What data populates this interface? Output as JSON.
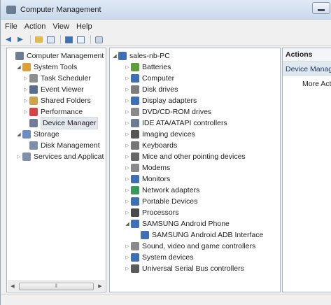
{
  "window": {
    "title": "Computer Management"
  },
  "menu": [
    "File",
    "Action",
    "View",
    "Help"
  ],
  "toolbar": [
    "back-arrow-icon",
    "forward-arrow-icon",
    "up-folder-icon",
    "show-hide-tree-icon",
    "properties-icon",
    "help-icon",
    "scan-hardware-icon"
  ],
  "left_tree": [
    {
      "label": "Computer Management",
      "level": 0,
      "arrow": "",
      "icon": "computer-management-icon",
      "color": "#6b7d93"
    },
    {
      "label": "System Tools",
      "level": 1,
      "arrow": "open",
      "icon": "system-tools-icon",
      "color": "#d9a23a"
    },
    {
      "label": "Task Scheduler",
      "level": 2,
      "arrow": "closed",
      "icon": "clock-icon",
      "color": "#8f8f8f"
    },
    {
      "label": "Event Viewer",
      "level": 2,
      "arrow": "closed",
      "icon": "event-viewer-icon",
      "color": "#5a6d8a"
    },
    {
      "label": "Shared Folders",
      "level": 2,
      "arrow": "closed",
      "icon": "shared-folders-icon",
      "color": "#c9a44a"
    },
    {
      "label": "Performance",
      "level": 2,
      "arrow": "closed",
      "icon": "performance-icon",
      "color": "#d64545"
    },
    {
      "label": "Device Manager",
      "level": 2,
      "arrow": "",
      "icon": "device-manager-icon",
      "color": "#6f7f96",
      "selected": true
    },
    {
      "label": "Storage",
      "level": 1,
      "arrow": "open",
      "icon": "storage-icon",
      "color": "#6b8cc0"
    },
    {
      "label": "Disk Management",
      "level": 2,
      "arrow": "",
      "icon": "disk-management-icon",
      "color": "#7d8ea5"
    },
    {
      "label": "Services and Applicat",
      "level": 1,
      "arrow": "closed",
      "icon": "services-icon",
      "color": "#7f8fa8"
    }
  ],
  "device_tree": {
    "root": {
      "label": "sales-nb-PC",
      "icon": "computer-icon",
      "color": "#3f6fb5"
    },
    "items": [
      {
        "label": "Batteries",
        "icon": "battery-icon",
        "color": "#5da03b"
      },
      {
        "label": "Computer",
        "icon": "computer-icon",
        "color": "#3f6fb5"
      },
      {
        "label": "Disk drives",
        "icon": "disk-drive-icon",
        "color": "#7d7d7d"
      },
      {
        "label": "Display adapters",
        "icon": "display-adapter-icon",
        "color": "#3f6fb5"
      },
      {
        "label": "DVD/CD-ROM drives",
        "icon": "dvd-drive-icon",
        "color": "#8a8a8a"
      },
      {
        "label": "IDE ATA/ATAPI controllers",
        "icon": "ide-controller-icon",
        "color": "#6b7d93"
      },
      {
        "label": "Imaging devices",
        "icon": "camera-icon",
        "color": "#555555"
      },
      {
        "label": "Keyboards",
        "icon": "keyboard-icon",
        "color": "#777777"
      },
      {
        "label": "Mice and other pointing devices",
        "icon": "mouse-icon",
        "color": "#666666"
      },
      {
        "label": "Modems",
        "icon": "modem-icon",
        "color": "#8a8a8a"
      },
      {
        "label": "Monitors",
        "icon": "monitor-icon",
        "color": "#3f6fb5"
      },
      {
        "label": "Network adapters",
        "icon": "network-adapter-icon",
        "color": "#3a9a5a"
      },
      {
        "label": "Portable Devices",
        "icon": "portable-device-icon",
        "color": "#3f6fb5"
      },
      {
        "label": "Processors",
        "icon": "processor-icon",
        "color": "#4a4a4a"
      },
      {
        "label": "SAMSUNG Android Phone",
        "icon": "phone-icon",
        "color": "#3f6fb5",
        "expanded": true
      },
      {
        "label": "SAMSUNG Android ADB Interface",
        "icon": "phone-icon",
        "color": "#3f6fb5",
        "child": true
      },
      {
        "label": "Sound, video and game controllers",
        "icon": "speaker-icon",
        "color": "#8a8a8a"
      },
      {
        "label": "System devices",
        "icon": "system-devices-icon",
        "color": "#3f6fb5"
      },
      {
        "label": "Universal Serial Bus controllers",
        "icon": "usb-icon",
        "color": "#5a5a5a"
      }
    ]
  },
  "actions": {
    "header": "Actions",
    "section": "Device Manager",
    "more": "More Actions"
  }
}
